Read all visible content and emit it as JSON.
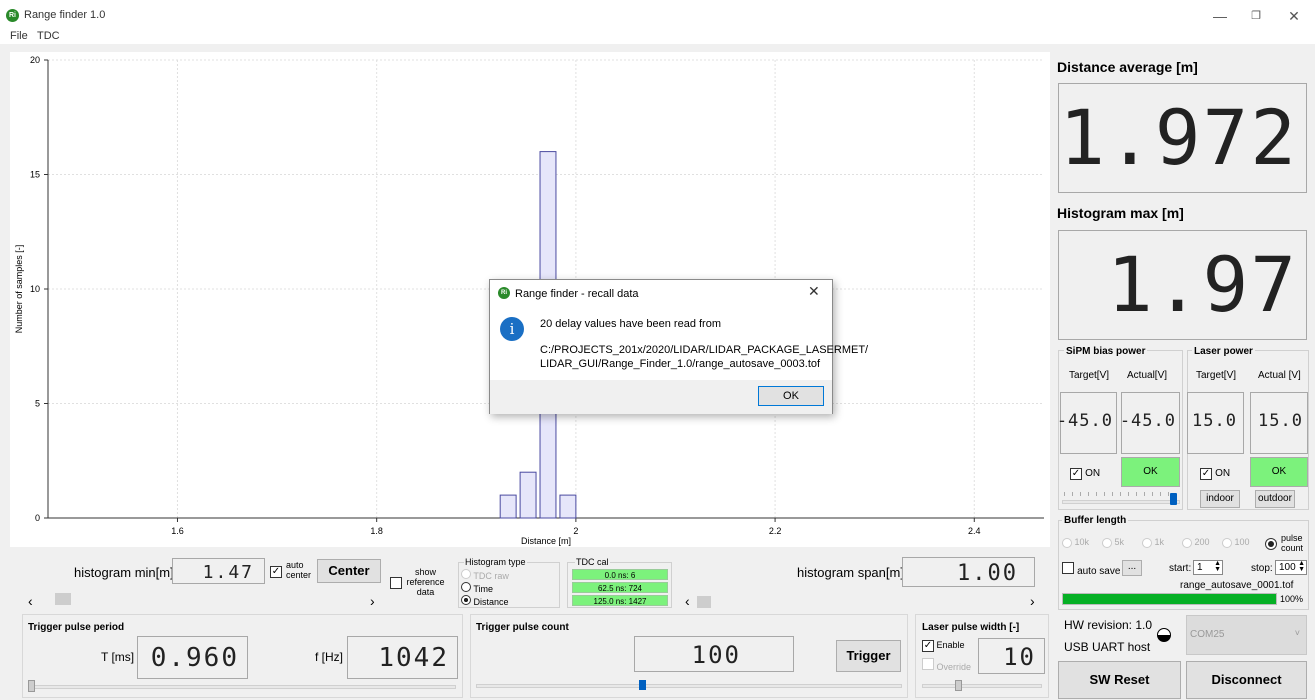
{
  "window": {
    "title": "Range finder 1.0",
    "menu": [
      "File",
      "TDC"
    ]
  },
  "chart_data": {
    "type": "bar",
    "xlabel": "Distance [m]",
    "ylabel": "Number of samples [-]",
    "xlim": [
      1.47,
      2.47
    ],
    "ylim": [
      0,
      20
    ],
    "xticks": [
      "1.6",
      "1.8",
      "2",
      "2.2",
      "2.4"
    ],
    "yticks": [
      "0",
      "5",
      "10",
      "15",
      "20"
    ],
    "bin_width": 0.016,
    "bars": [
      {
        "x": 1.932,
        "y": 1
      },
      {
        "x": 1.952,
        "y": 2
      },
      {
        "x": 1.972,
        "y": 16
      },
      {
        "x": 1.992,
        "y": 1
      }
    ],
    "grid": true,
    "bar_color": "#e6e6fa",
    "bar_edge": "#4a4aa0"
  },
  "dialog": {
    "title": "Range finder - recall data",
    "line1": "20 delay values have been read from",
    "path_line1": "C:/PROJECTS_201x/2020/LIDAR/LIDAR_PACKAGE_LASERMET/",
    "path_line2": "LIDAR_GUI/Range_Finder_1.0/range_autosave_0003.tof",
    "ok_label": "OK"
  },
  "right": {
    "distance_avg_label": "Distance average [m]",
    "distance_avg_value": "1.972",
    "hist_max_label": "Histogram max [m]",
    "hist_max_value": "1.97",
    "sipm": {
      "title": "SiPM bias power",
      "target_label": "Target[V]",
      "actual_label": "Actual[V]",
      "target_value": "-45.0",
      "actual_value": "-45.0",
      "on_label": "ON",
      "status": "OK",
      "slider_level": 0.96
    },
    "laser": {
      "title": "Laser power",
      "target_label": "Target[V]",
      "actual_label": "Actual [V]",
      "target_value": "15.0",
      "actual_value": "15.0",
      "on_label": "ON",
      "status": "OK",
      "indoor_label": "indoor",
      "outdoor_label": "outdoor"
    },
    "buffer": {
      "title": "Buffer length",
      "options": [
        "10k",
        "5k",
        "1k",
        "200",
        "100"
      ],
      "pulse_label_1": "pulse",
      "pulse_label_2": "count",
      "auto_save_label": "auto save",
      "browse_label": "...",
      "start_label": "start:",
      "start_value": "1",
      "stop_label": "stop:",
      "stop_value": "100",
      "filename": "range_autosave_0001.tof",
      "progress": 100,
      "progress_text": "100%"
    },
    "hw_revision": "HW revision: 1.0",
    "usb": "USB UART host",
    "com_port": "COM25",
    "sw_reset_label": "SW Reset",
    "disconnect_label": "Disconnect"
  },
  "controls": {
    "hist_min_label": "histogram min[m]",
    "hist_min_value": "1.47",
    "auto_center_1": "auto",
    "auto_center_2": "center",
    "center_label": "Center",
    "show_ref_1": "show",
    "show_ref_2": "reference",
    "show_ref_3": "data",
    "hist_type_title": "Histogram type",
    "hist_type_options": [
      "TDC raw",
      "Time",
      "Distance"
    ],
    "tdc_cal_title": "TDC cal",
    "tdc_cal_rows": [
      "0.0 ns: 6",
      "62.5 ns: 724",
      "125.0 ns: 1427"
    ],
    "hist_span_label": "histogram span[m]",
    "hist_span_value": "1.00",
    "left_arrow": "‹",
    "right_arrow": "›"
  },
  "trigger_period": {
    "title": "Trigger pulse period",
    "t_label": "T [ms]",
    "t_value": "0.960",
    "f_label": "f [Hz]",
    "f_value": "1042"
  },
  "trigger_count": {
    "title": "Trigger pulse count",
    "value": "100",
    "button": "Trigger"
  },
  "laser_width": {
    "title": "Laser pulse width [-]",
    "enable_label": "Enable",
    "override_label": "Override",
    "value": "10"
  }
}
